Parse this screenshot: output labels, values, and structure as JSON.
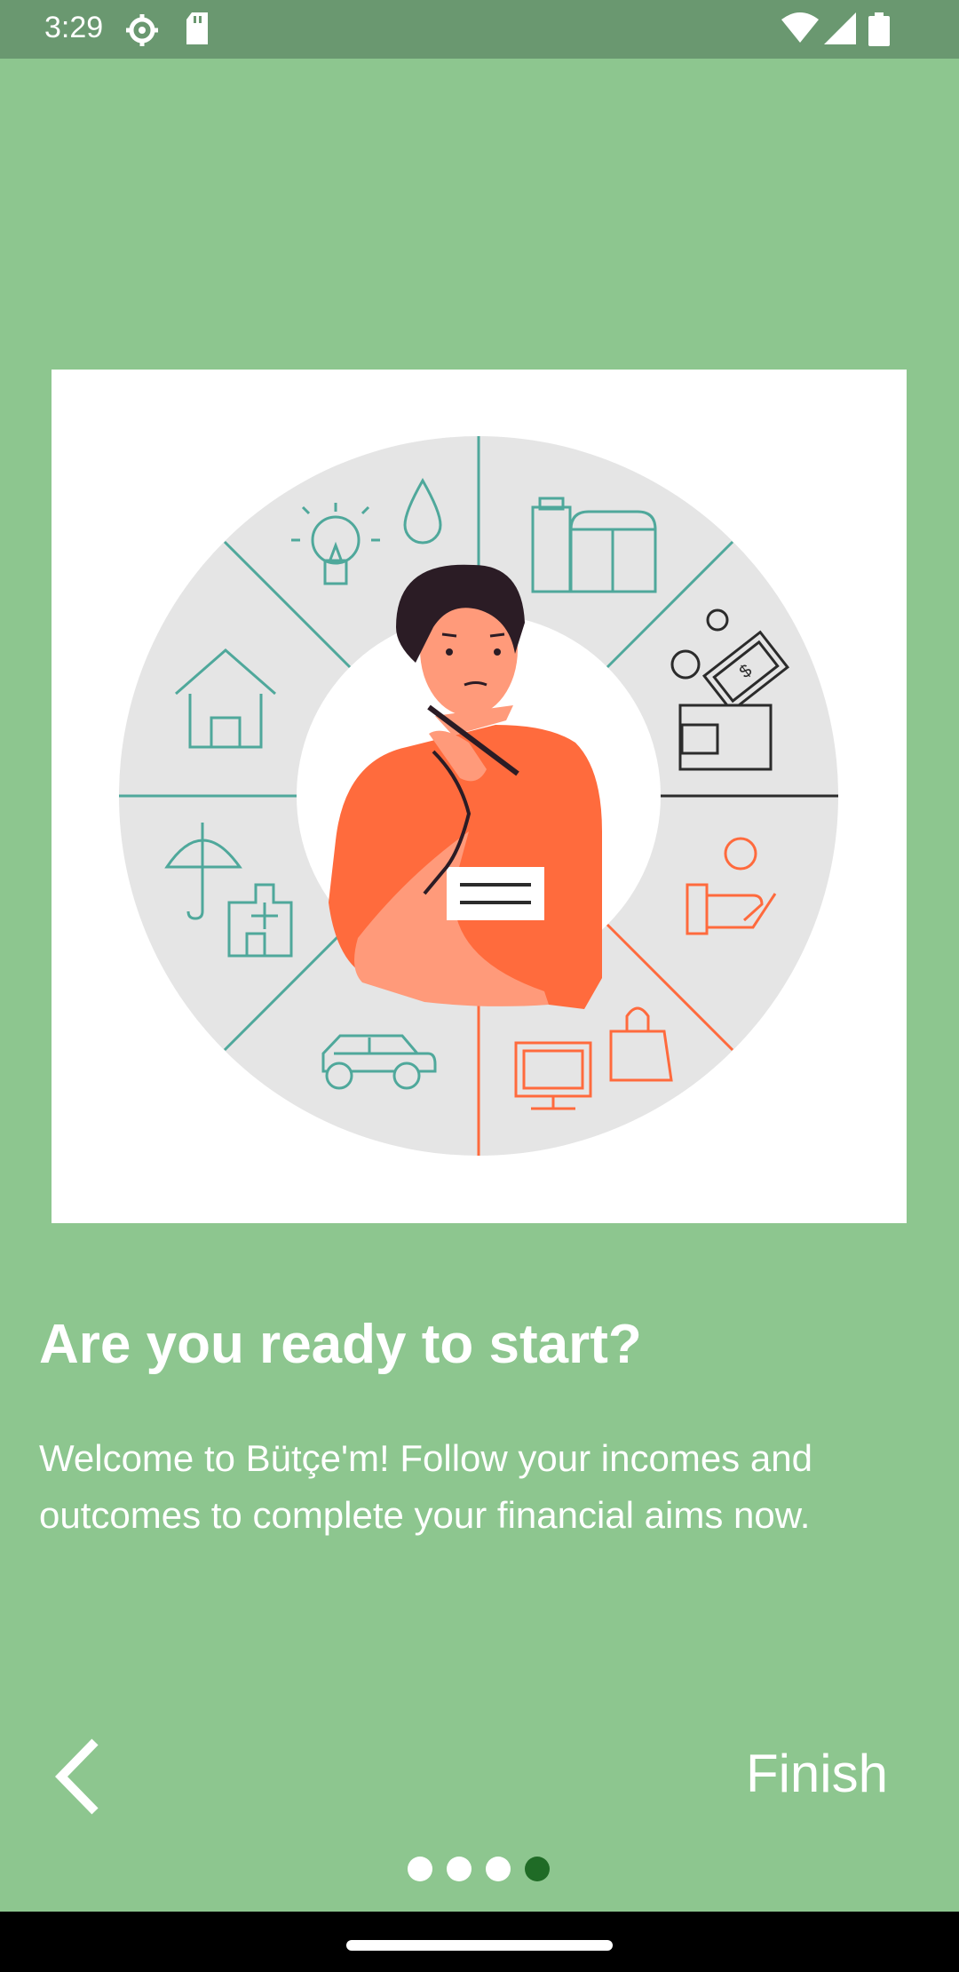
{
  "status_bar": {
    "time": "3:29",
    "icons": [
      "settings-icon",
      "sd-card-icon",
      "wifi-icon",
      "signal-icon",
      "battery-icon"
    ]
  },
  "onboarding": {
    "title": "Are you ready to start?",
    "description": "Welcome to Bütçe'm! Follow your incomes and outcomes to complete your financial aims now.",
    "illustration": "budget-wheel-thinking-man",
    "page_index": 4,
    "page_count": 4
  },
  "navigation": {
    "back_icon": "chevron-left-icon",
    "finish_label": "Finish"
  },
  "colors": {
    "background": "#8dc68f",
    "status_bar": "#6a9870",
    "active_dot": "#1f6b26",
    "teal_icons": "#4fa89b",
    "orange": "#ff6a3d"
  }
}
